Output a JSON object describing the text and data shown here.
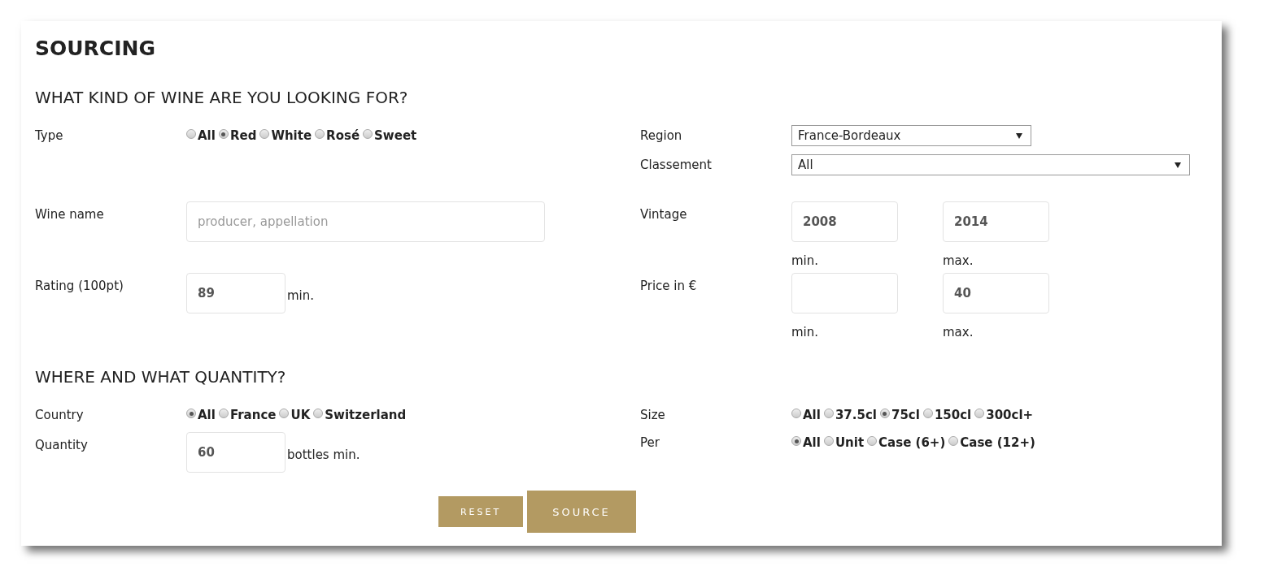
{
  "title": "SOURCING",
  "sections": [
    {
      "heading": "WHAT KIND OF WINE ARE YOU LOOKING FOR?",
      "rows": [
        {
          "kind": "top",
          "left": [
            {
              "kind": "radio",
              "label": "Type",
              "options": [
                {
                  "label": "All",
                  "selected": false
                },
                {
                  "label": "Red",
                  "selected": true
                },
                {
                  "label": "White",
                  "selected": false
                },
                {
                  "label": "Rosé",
                  "selected": false
                },
                {
                  "label": "Sweet",
                  "selected": false
                }
              ]
            }
          ],
          "right": [
            {
              "kind": "select",
              "label": "Region",
              "value": "France-Bordeaux",
              "wide": false
            },
            {
              "kind": "select",
              "label": "Classement",
              "value": "All",
              "wide": true
            }
          ]
        },
        {
          "kind": "input",
          "left": [
            {
              "kind": "text",
              "label": "Wine name",
              "placeholder": "producer, appellation",
              "wide": true
            }
          ],
          "right": [
            {
              "kind": "range",
              "label": "Vintage",
              "min": {
                "value": "2008",
                "caption": "min."
              },
              "max": {
                "value": "2014",
                "caption": "max."
              }
            }
          ]
        },
        {
          "kind": "input",
          "left": [
            {
              "kind": "text",
              "label": "Rating (100pt)",
              "value": "89",
              "suffix": "min.",
              "wide": false
            }
          ],
          "right": [
            {
              "kind": "range",
              "label": "Price in €",
              "min": {
                "caption": "min."
              },
              "max": {
                "value": "40",
                "caption": "max."
              }
            }
          ]
        }
      ]
    },
    {
      "heading": "WHERE AND WHAT QUANTITY?",
      "rows": [
        {
          "kind": "compact",
          "left": [
            {
              "kind": "radio",
              "label": "Country",
              "options": [
                {
                  "label": "All",
                  "selected": true
                },
                {
                  "label": "France",
                  "selected": false
                },
                {
                  "label": "UK",
                  "selected": false
                },
                {
                  "label": "Switzerland",
                  "selected": false
                }
              ]
            }
          ],
          "right": [
            {
              "kind": "radio",
              "label": "Size",
              "options": [
                {
                  "label": "All",
                  "selected": false
                },
                {
                  "label": "37.5cl",
                  "selected": false
                },
                {
                  "label": "75cl",
                  "selected": true
                },
                {
                  "label": "150cl",
                  "selected": false
                },
                {
                  "label": "300cl+",
                  "selected": false
                }
              ]
            }
          ]
        },
        {
          "kind": "compact",
          "left": [
            {
              "kind": "text",
              "label": "Quantity",
              "value": "60",
              "suffix": "bottles min.",
              "wide": false
            }
          ],
          "right": [
            {
              "kind": "radio",
              "label": "Per",
              "options": [
                {
                  "label": "All",
                  "selected": true
                },
                {
                  "label": "Unit",
                  "selected": false
                },
                {
                  "label": "Case (6+)",
                  "selected": false
                },
                {
                  "label": "Case (12+)",
                  "selected": false
                }
              ]
            }
          ]
        }
      ]
    }
  ],
  "buttons": [
    {
      "label": "RESET",
      "kind": "secondary"
    },
    {
      "label": "SOURCE",
      "kind": "primary"
    }
  ]
}
